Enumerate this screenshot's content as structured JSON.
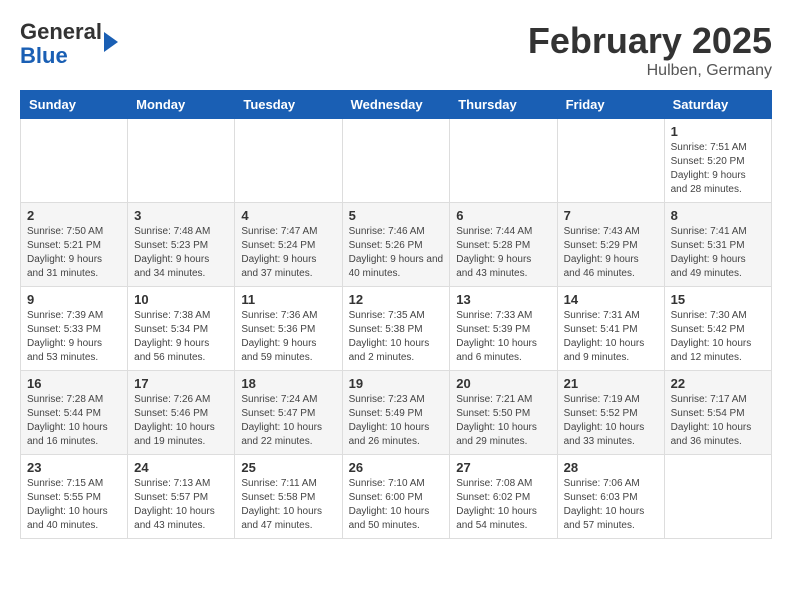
{
  "header": {
    "logo": {
      "line1": "General",
      "line2": "Blue"
    },
    "month": "February 2025",
    "location": "Hulben, Germany"
  },
  "weekdays": [
    "Sunday",
    "Monday",
    "Tuesday",
    "Wednesday",
    "Thursday",
    "Friday",
    "Saturday"
  ],
  "weeks": [
    [
      null,
      null,
      null,
      null,
      null,
      null,
      {
        "day": 1,
        "info": "Sunrise: 7:51 AM\nSunset: 5:20 PM\nDaylight: 9 hours and 28 minutes."
      }
    ],
    [
      {
        "day": 2,
        "info": "Sunrise: 7:50 AM\nSunset: 5:21 PM\nDaylight: 9 hours and 31 minutes."
      },
      {
        "day": 3,
        "info": "Sunrise: 7:48 AM\nSunset: 5:23 PM\nDaylight: 9 hours and 34 minutes."
      },
      {
        "day": 4,
        "info": "Sunrise: 7:47 AM\nSunset: 5:24 PM\nDaylight: 9 hours and 37 minutes."
      },
      {
        "day": 5,
        "info": "Sunrise: 7:46 AM\nSunset: 5:26 PM\nDaylight: 9 hours and 40 minutes."
      },
      {
        "day": 6,
        "info": "Sunrise: 7:44 AM\nSunset: 5:28 PM\nDaylight: 9 hours and 43 minutes."
      },
      {
        "day": 7,
        "info": "Sunrise: 7:43 AM\nSunset: 5:29 PM\nDaylight: 9 hours and 46 minutes."
      },
      {
        "day": 8,
        "info": "Sunrise: 7:41 AM\nSunset: 5:31 PM\nDaylight: 9 hours and 49 minutes."
      }
    ],
    [
      {
        "day": 9,
        "info": "Sunrise: 7:39 AM\nSunset: 5:33 PM\nDaylight: 9 hours and 53 minutes."
      },
      {
        "day": 10,
        "info": "Sunrise: 7:38 AM\nSunset: 5:34 PM\nDaylight: 9 hours and 56 minutes."
      },
      {
        "day": 11,
        "info": "Sunrise: 7:36 AM\nSunset: 5:36 PM\nDaylight: 9 hours and 59 minutes."
      },
      {
        "day": 12,
        "info": "Sunrise: 7:35 AM\nSunset: 5:38 PM\nDaylight: 10 hours and 2 minutes."
      },
      {
        "day": 13,
        "info": "Sunrise: 7:33 AM\nSunset: 5:39 PM\nDaylight: 10 hours and 6 minutes."
      },
      {
        "day": 14,
        "info": "Sunrise: 7:31 AM\nSunset: 5:41 PM\nDaylight: 10 hours and 9 minutes."
      },
      {
        "day": 15,
        "info": "Sunrise: 7:30 AM\nSunset: 5:42 PM\nDaylight: 10 hours and 12 minutes."
      }
    ],
    [
      {
        "day": 16,
        "info": "Sunrise: 7:28 AM\nSunset: 5:44 PM\nDaylight: 10 hours and 16 minutes."
      },
      {
        "day": 17,
        "info": "Sunrise: 7:26 AM\nSunset: 5:46 PM\nDaylight: 10 hours and 19 minutes."
      },
      {
        "day": 18,
        "info": "Sunrise: 7:24 AM\nSunset: 5:47 PM\nDaylight: 10 hours and 22 minutes."
      },
      {
        "day": 19,
        "info": "Sunrise: 7:23 AM\nSunset: 5:49 PM\nDaylight: 10 hours and 26 minutes."
      },
      {
        "day": 20,
        "info": "Sunrise: 7:21 AM\nSunset: 5:50 PM\nDaylight: 10 hours and 29 minutes."
      },
      {
        "day": 21,
        "info": "Sunrise: 7:19 AM\nSunset: 5:52 PM\nDaylight: 10 hours and 33 minutes."
      },
      {
        "day": 22,
        "info": "Sunrise: 7:17 AM\nSunset: 5:54 PM\nDaylight: 10 hours and 36 minutes."
      }
    ],
    [
      {
        "day": 23,
        "info": "Sunrise: 7:15 AM\nSunset: 5:55 PM\nDaylight: 10 hours and 40 minutes."
      },
      {
        "day": 24,
        "info": "Sunrise: 7:13 AM\nSunset: 5:57 PM\nDaylight: 10 hours and 43 minutes."
      },
      {
        "day": 25,
        "info": "Sunrise: 7:11 AM\nSunset: 5:58 PM\nDaylight: 10 hours and 47 minutes."
      },
      {
        "day": 26,
        "info": "Sunrise: 7:10 AM\nSunset: 6:00 PM\nDaylight: 10 hours and 50 minutes."
      },
      {
        "day": 27,
        "info": "Sunrise: 7:08 AM\nSunset: 6:02 PM\nDaylight: 10 hours and 54 minutes."
      },
      {
        "day": 28,
        "info": "Sunrise: 7:06 AM\nSunset: 6:03 PM\nDaylight: 10 hours and 57 minutes."
      },
      null
    ]
  ]
}
